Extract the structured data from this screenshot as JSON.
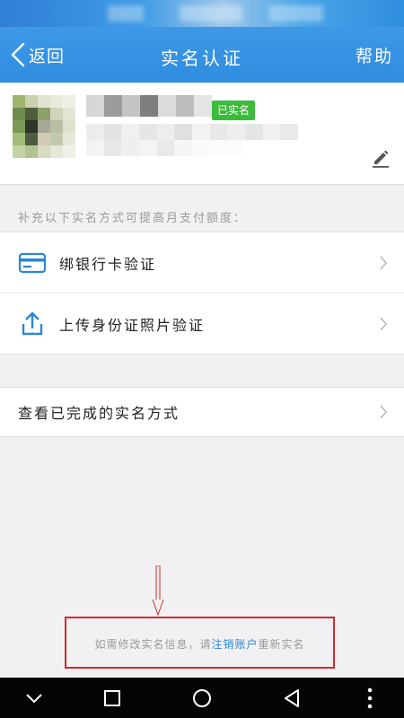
{
  "header": {
    "back_label": "返回",
    "title": "实名认证",
    "help_label": "帮助"
  },
  "profile": {
    "badge": "已实名"
  },
  "hint": "补充以下实名方式可提高月支付额度：",
  "options": [
    {
      "label": "绑银行卡验证",
      "icon": "bank-card-icon"
    },
    {
      "label": "上传身份证照片验证",
      "icon": "upload-icon"
    }
  ],
  "view_completed": {
    "label": "查看已完成的实名方式"
  },
  "footer_note": {
    "prefix": "如需修改实名信息，请",
    "link": "注销账户",
    "suffix": "重新实名"
  },
  "colors": {
    "header": "#2f8ddf",
    "badge": "#3dbb3d",
    "link": "#2a86d6",
    "annotation": "#d62a2a"
  },
  "navbar": {
    "icons": [
      "chevron-down-icon",
      "recents-square-icon",
      "home-circle-icon",
      "back-triangle-icon",
      "more-dots-icon"
    ]
  }
}
